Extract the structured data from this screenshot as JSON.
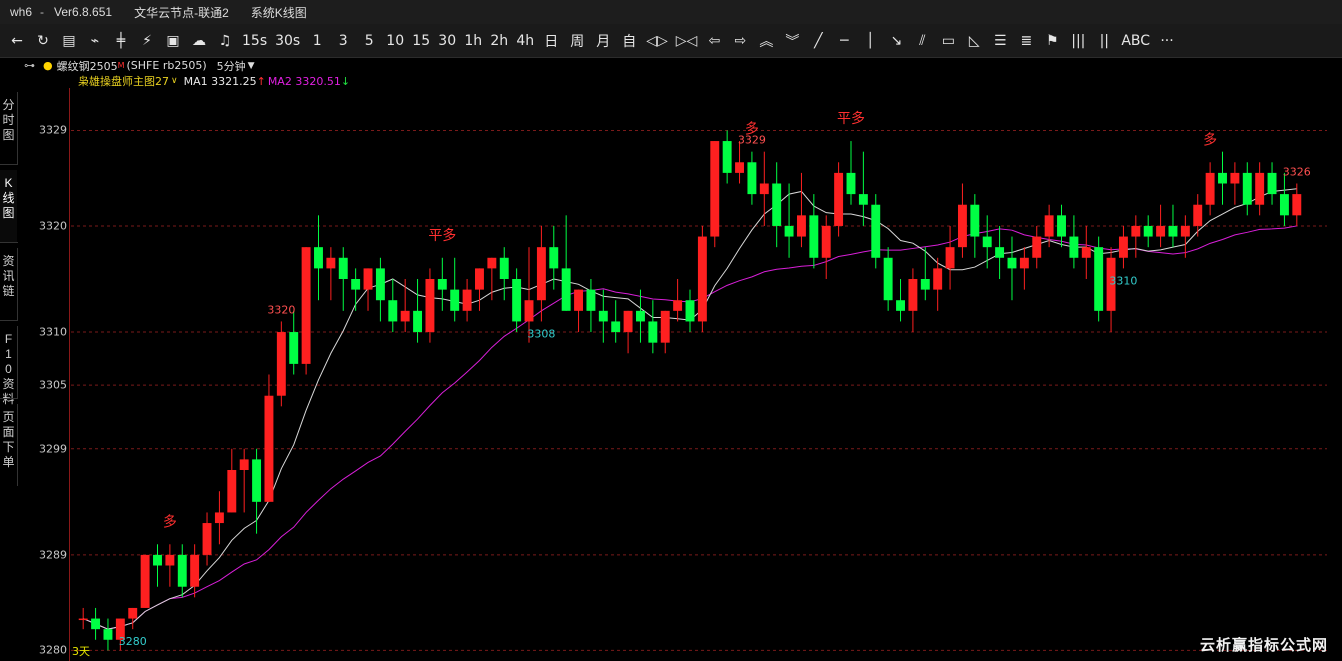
{
  "titlebar": {
    "app": "wh6",
    "separator": "-",
    "version": "Ver6.8.651",
    "server": "文华云节点-联通2",
    "window": "系统K线图"
  },
  "toolbar": {
    "items": [
      {
        "label": "←",
        "icon": "back-arrow-icon"
      },
      {
        "label": "↻",
        "icon": "refresh-icon"
      },
      {
        "label": "▤",
        "icon": "table-icon"
      },
      {
        "label": "⌁",
        "icon": "line-chart-icon"
      },
      {
        "label": "╪",
        "icon": "candle-icon"
      },
      {
        "label": "⚡",
        "icon": "flash-icon"
      },
      {
        "label": "▣",
        "icon": "window-icon"
      },
      {
        "label": "☁",
        "icon": "cloud-icon"
      },
      {
        "label": "♫",
        "icon": "bell-icon"
      },
      {
        "label": "15s"
      },
      {
        "label": "30s"
      },
      {
        "label": "1"
      },
      {
        "label": "3"
      },
      {
        "label": "5"
      },
      {
        "label": "10"
      },
      {
        "label": "15"
      },
      {
        "label": "30"
      },
      {
        "label": "1h"
      },
      {
        "label": "2h"
      },
      {
        "label": "4h"
      },
      {
        "label": "日"
      },
      {
        "label": "周"
      },
      {
        "label": "月"
      },
      {
        "label": "自"
      },
      {
        "label": "◁▷",
        "icon": "zoom-icon"
      },
      {
        "label": "▷◁",
        "icon": "shrink-icon"
      },
      {
        "label": "⇦",
        "icon": "left-icon"
      },
      {
        "label": "⇨",
        "icon": "right-icon"
      },
      {
        "label": "︽",
        "icon": "up-icon"
      },
      {
        "label": "︾",
        "icon": "down-icon"
      },
      {
        "label": "╱",
        "icon": "line-tool-icon"
      },
      {
        "label": "─",
        "icon": "hline-tool-icon"
      },
      {
        "label": "│",
        "icon": "vline-tool-icon"
      },
      {
        "label": "↘",
        "icon": "ray-tool-icon"
      },
      {
        "label": "⫽",
        "icon": "parallel-tool-icon"
      },
      {
        "label": "▭",
        "icon": "rect-tool-icon"
      },
      {
        "label": "◺",
        "icon": "triangle-tool-icon"
      },
      {
        "label": "☰",
        "icon": "fib-tool-icon"
      },
      {
        "label": "≣",
        "icon": "gann-tool-icon"
      },
      {
        "label": "⚑",
        "icon": "flag-tool-icon"
      },
      {
        "label": "|||",
        "icon": "cycle-tool-icon"
      },
      {
        "label": "||",
        "icon": "bars-tool-icon"
      },
      {
        "label": "ABC",
        "icon": "text-tool-icon"
      },
      {
        "label": "···",
        "icon": "more-icon"
      }
    ]
  },
  "sidebar": {
    "tabs": [
      "分时图",
      "K线图",
      "资讯链",
      "F10资料",
      "页面下单"
    ]
  },
  "infobar": {
    "marker": "●",
    "symbol": "螺纹钢2505",
    "symbol_sup": "M",
    "code": "(SHFE rb2505)",
    "period": "5分钟"
  },
  "legend": {
    "indicator": "枭雄操盘师主图27",
    "ma1_label": "MA1 3321.25",
    "ma1_arrow": "↑",
    "ma2_label": "MA2 3320.51",
    "ma2_arrow": "↓"
  },
  "colors": {
    "up": "#ff2020",
    "down": "#00ff44",
    "ma1": "#d8d8d8",
    "ma2": "#d81fd8",
    "grid": "#7a1a1a",
    "highlow": "#ff5050",
    "lowlabel": "#33cccc"
  },
  "watermark": "云析赢指标公式网",
  "range_label": "3天",
  "chart_data": {
    "type": "candlestick",
    "y_ticks": [
      3329,
      3320,
      3310,
      3305,
      3299,
      3289,
      3280
    ],
    "annotations": [
      {
        "text": "3320",
        "kind": "high",
        "bar": 16
      },
      {
        "text": "3329",
        "kind": "high",
        "bar": 54
      },
      {
        "text": "3326",
        "kind": "high",
        "bar": 98
      },
      {
        "text": "3308",
        "kind": "low",
        "bar": 37
      },
      {
        "text": "3310",
        "kind": "low",
        "bar": 84
      },
      {
        "text": "3280",
        "kind": "low",
        "bar": 4
      },
      {
        "text": "多",
        "kind": "signal",
        "bar": 7
      },
      {
        "text": "平多",
        "kind": "signal",
        "bar": 29
      },
      {
        "text": "多",
        "kind": "signal",
        "bar": 54
      },
      {
        "text": "平多",
        "kind": "signal",
        "bar": 62
      },
      {
        "text": "多",
        "kind": "signal",
        "bar": 91
      }
    ],
    "candles": [
      [
        3283,
        3284,
        3282,
        3283
      ],
      [
        3283,
        3284,
        3281,
        3282
      ],
      [
        3282,
        3283,
        3280,
        3281
      ],
      [
        3281,
        3283,
        3280,
        3283
      ],
      [
        3283,
        3284,
        3282,
        3284
      ],
      [
        3284,
        3289,
        3284,
        3289
      ],
      [
        3289,
        3290,
        3286,
        3288
      ],
      [
        3288,
        3290,
        3286,
        3289
      ],
      [
        3289,
        3290,
        3285,
        3286
      ],
      [
        3286,
        3290,
        3285,
        3289
      ],
      [
        3289,
        3293,
        3288,
        3292
      ],
      [
        3292,
        3295,
        3290,
        3293
      ],
      [
        3293,
        3299,
        3293,
        3297
      ],
      [
        3297,
        3299,
        3293,
        3298
      ],
      [
        3298,
        3299,
        3291,
        3294
      ],
      [
        3294,
        3306,
        3294,
        3304
      ],
      [
        3304,
        3311,
        3303,
        3310
      ],
      [
        3310,
        3312,
        3306,
        3307
      ],
      [
        3307,
        3318,
        3306,
        3318
      ],
      [
        3318,
        3321,
        3313,
        3316
      ],
      [
        3316,
        3318,
        3313,
        3317
      ],
      [
        3317,
        3318,
        3312,
        3315
      ],
      [
        3315,
        3316,
        3312,
        3314
      ],
      [
        3314,
        3316,
        3312,
        3316
      ],
      [
        3316,
        3317,
        3311,
        3313
      ],
      [
        3313,
        3315,
        3310,
        3311
      ],
      [
        3311,
        3315,
        3310,
        3312
      ],
      [
        3312,
        3315,
        3309,
        3310
      ],
      [
        3310,
        3316,
        3309,
        3315
      ],
      [
        3315,
        3317,
        3312,
        3314
      ],
      [
        3314,
        3317,
        3311,
        3312
      ],
      [
        3312,
        3315,
        3311,
        3314
      ],
      [
        3314,
        3316,
        3312,
        3316
      ],
      [
        3316,
        3317,
        3313,
        3317
      ],
      [
        3317,
        3318,
        3313,
        3315
      ],
      [
        3315,
        3316,
        3310,
        3311
      ],
      [
        3311,
        3318,
        3309,
        3313
      ],
      [
        3313,
        3320,
        3311,
        3318
      ],
      [
        3318,
        3320,
        3314,
        3316
      ],
      [
        3316,
        3321,
        3312,
        3312
      ],
      [
        3312,
        3314,
        3310,
        3314
      ],
      [
        3314,
        3315,
        3310,
        3312
      ],
      [
        3312,
        3314,
        3309,
        3311
      ],
      [
        3311,
        3313,
        3309,
        3310
      ],
      [
        3310,
        3312,
        3308,
        3312
      ],
      [
        3312,
        3314,
        3309,
        3311
      ],
      [
        3311,
        3313,
        3308,
        3309
      ],
      [
        3309,
        3312,
        3308,
        3312
      ],
      [
        3312,
        3315,
        3311,
        3313
      ],
      [
        3313,
        3314,
        3310,
        3311
      ],
      [
        3311,
        3320,
        3310,
        3319
      ],
      [
        3319,
        3328,
        3318,
        3328
      ],
      [
        3328,
        3329,
        3324,
        3325
      ],
      [
        3325,
        3328,
        3324,
        3326
      ],
      [
        3326,
        3327,
        3322,
        3323
      ],
      [
        3323,
        3327,
        3320,
        3324
      ],
      [
        3324,
        3326,
        3318,
        3320
      ],
      [
        3320,
        3324,
        3317,
        3319
      ],
      [
        3319,
        3325,
        3318,
        3321
      ],
      [
        3321,
        3323,
        3316,
        3317
      ],
      [
        3317,
        3321,
        3315,
        3320
      ],
      [
        3320,
        3326,
        3319,
        3325
      ],
      [
        3325,
        3328,
        3322,
        3323
      ],
      [
        3323,
        3327,
        3320,
        3322
      ],
      [
        3322,
        3323,
        3316,
        3317
      ],
      [
        3317,
        3318,
        3312,
        3313
      ],
      [
        3313,
        3315,
        3311,
        3312
      ],
      [
        3312,
        3316,
        3310,
        3315
      ],
      [
        3315,
        3318,
        3313,
        3314
      ],
      [
        3314,
        3317,
        3312,
        3316
      ],
      [
        3316,
        3320,
        3314,
        3318
      ],
      [
        3318,
        3324,
        3317,
        3322
      ],
      [
        3322,
        3323,
        3317,
        3319
      ],
      [
        3319,
        3321,
        3316,
        3318
      ],
      [
        3318,
        3320,
        3315,
        3317
      ],
      [
        3317,
        3319,
        3313,
        3316
      ],
      [
        3316,
        3318,
        3314,
        3317
      ],
      [
        3317,
        3320,
        3316,
        3319
      ],
      [
        3319,
        3322,
        3318,
        3321
      ],
      [
        3321,
        3322,
        3318,
        3319
      ],
      [
        3319,
        3321,
        3316,
        3317
      ],
      [
        3317,
        3320,
        3315,
        3318
      ],
      [
        3318,
        3319,
        3311,
        3312
      ],
      [
        3312,
        3318,
        3310,
        3317
      ],
      [
        3317,
        3320,
        3316,
        3319
      ],
      [
        3319,
        3321,
        3317,
        3320
      ],
      [
        3320,
        3321,
        3318,
        3319
      ],
      [
        3319,
        3322,
        3318,
        3320
      ],
      [
        3320,
        3322,
        3318,
        3319
      ],
      [
        3319,
        3321,
        3317,
        3320
      ],
      [
        3320,
        3323,
        3319,
        3322
      ],
      [
        3322,
        3326,
        3321,
        3325
      ],
      [
        3325,
        3327,
        3322,
        3324
      ],
      [
        3324,
        3326,
        3322,
        3325
      ],
      [
        3325,
        3326,
        3321,
        3322
      ],
      [
        3322,
        3326,
        3321,
        3325
      ],
      [
        3325,
        3326,
        3322,
        3323
      ],
      [
        3323,
        3325,
        3320,
        3321
      ],
      [
        3321,
        3324,
        3320,
        3323
      ]
    ]
  }
}
